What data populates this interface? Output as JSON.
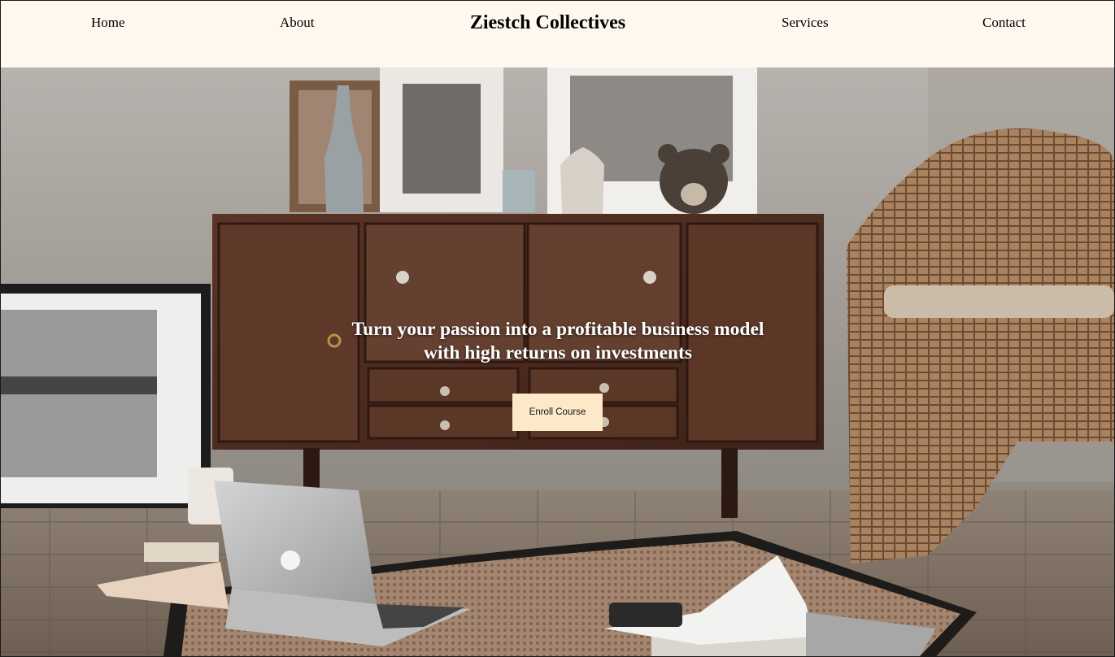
{
  "nav": {
    "home": "Home",
    "about": "About",
    "brand": "Ziestch Collectives",
    "services": "Services",
    "contact": "Contact"
  },
  "hero": {
    "headline_line1": "Turn your passion into a profitable business model",
    "headline_line2": "with high returns on investments",
    "cta_label": "Enroll Course"
  },
  "colors": {
    "nav_bg": "#fff8ef",
    "cta_bg": "#fde8c8",
    "text_dark": "#000000",
    "text_light": "#ffffff"
  }
}
